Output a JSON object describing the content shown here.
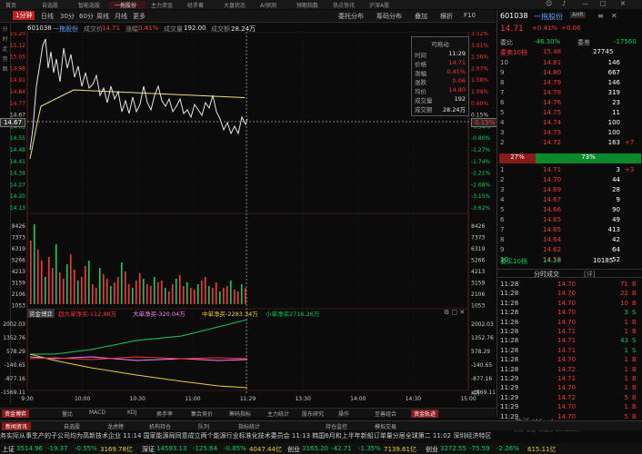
{
  "top_tabs": [
    "首页",
    "自选股",
    "智能选股",
    "一拖股份",
    "主力资金",
    "经手黄",
    "大盘状态",
    "AI预测",
    "预期指数",
    "热点快讯",
    "沪深A股"
  ],
  "active_top_tab_index": 3,
  "toolbar": {
    "period_label": "1分钟",
    "items": [
      "日线",
      "30分",
      "60分",
      "周线",
      "月线",
      "更多"
    ],
    "menus": [
      "委托分布",
      "筹码分布",
      "叠加",
      "横折"
    ],
    "f10": "F10"
  },
  "chart_info": {
    "code": "601038",
    "name": "一拖股份",
    "price_label": "成交价",
    "price": "14.71",
    "change_label": "涨幅",
    "change": "0.41%",
    "volume_label": "成交量",
    "volume": "192.00",
    "amount_label": "成交额",
    "amount": "28.24万"
  },
  "left_strip": [
    "分",
    "时",
    "走",
    "势",
    "图"
  ],
  "price_axis_left": [
    "15.20",
    "15.12",
    "15.05",
    "14.98",
    "14.91",
    "14.84",
    "14.77",
    "14.67",
    "14.61",
    "14.55",
    "14.48",
    "14.41",
    "14.34",
    "14.27",
    "14.20",
    "14.13"
  ],
  "price_axis_right": [
    "3.52%",
    "3.01%",
    "2.56%",
    "2.07%",
    "1.58%",
    "1.09%",
    "0.60%",
    "0.15%",
    "-0.34%",
    "-0.80%",
    "-1.27%",
    "-1.74%",
    "-2.21%",
    "-2.68%",
    "-3.15%",
    "-3.62%"
  ],
  "current_price_marker": "14.67",
  "current_pct_marker": "0.15%",
  "volume_axis": [
    "8426",
    "7373",
    "6319",
    "5266",
    "4213",
    "3159",
    "2106",
    "1053"
  ],
  "volume_axis_right": [
    "8426",
    "7373",
    "6319",
    "5266",
    "4213",
    "3159",
    "2106",
    "1053"
  ],
  "flow_legend": {
    "title": "资金博弈",
    "super": "超大单净买-112.88万",
    "big": "大单净买-320.04万",
    "mid": "中单净买-2283.34万",
    "small": "小单净买2716.26万"
  },
  "flow_axis": [
    "2002.03",
    "1352.76",
    "578.29",
    "-140.65",
    "-877.16",
    "-1569.11"
  ],
  "flow_axis_right": [
    "2002.03",
    "1352.76",
    "578.29",
    "-140.65",
    "-877.16",
    "-1569.11"
  ],
  "flow_unit": "X万",
  "time_axis": [
    "9:30",
    "10:00",
    "10:30",
    "11:00",
    "11:29",
    "13:30",
    "14:00",
    "14:30",
    "15:00"
  ],
  "cursor_time": "11:29",
  "tooltip": {
    "title": "可拖动",
    "rows": [
      {
        "k": "时间",
        "v": "11:29",
        "c": "white"
      },
      {
        "k": "价格",
        "v": "14.71",
        "c": "red"
      },
      {
        "k": "涨幅",
        "v": "0.41%",
        "c": "red"
      },
      {
        "k": "涨跌",
        "v": "0.06",
        "c": "red"
      },
      {
        "k": "均价",
        "v": "14.80",
        "c": "red"
      },
      {
        "k": "成交量",
        "v": "192",
        "c": "white"
      },
      {
        "k": "成交额",
        "v": "28.24万",
        "c": "white"
      }
    ]
  },
  "sidebar": {
    "code": "601038",
    "name": "一拖股份",
    "price": "14.71",
    "pct": "+0.41%",
    "chg": "+0.06",
    "wb_label": "委比",
    "wb": "-46.30%",
    "wc_label": "委差",
    "wc": "-17560",
    "sell_total_label": "委卖10档",
    "sell_total_price": "15.48",
    "sell_total_vol": "27745",
    "asks": [
      {
        "lvl": "10",
        "p": "14.81",
        "v": "146",
        "d": ""
      },
      {
        "lvl": "9",
        "p": "14.80",
        "v": "667",
        "d": ""
      },
      {
        "lvl": "8",
        "p": "14.79",
        "v": "146",
        "d": ""
      },
      {
        "lvl": "7",
        "p": "14.78",
        "v": "319",
        "d": ""
      },
      {
        "lvl": "6",
        "p": "14.76",
        "v": "23",
        "d": ""
      },
      {
        "lvl": "5",
        "p": "14.75",
        "v": "11",
        "d": ""
      },
      {
        "lvl": "4",
        "p": "14.74",
        "v": "100",
        "d": ""
      },
      {
        "lvl": "3",
        "p": "14.73",
        "v": "100",
        "d": ""
      },
      {
        "lvl": "2",
        "p": "14.72",
        "v": "163",
        "d": "+7"
      }
    ],
    "ratio_left": "27%",
    "ratio_right": "73%",
    "bids": [
      {
        "lvl": "1",
        "p": "14.71",
        "v": "3",
        "d": "+3"
      },
      {
        "lvl": "2",
        "p": "14.70",
        "v": "44",
        "d": ""
      },
      {
        "lvl": "3",
        "p": "14.69",
        "v": "28",
        "d": ""
      },
      {
        "lvl": "4",
        "p": "14.67",
        "v": "9",
        "d": ""
      },
      {
        "lvl": "5",
        "p": "14.66",
        "v": "90",
        "d": ""
      },
      {
        "lvl": "6",
        "p": "14.65",
        "v": "49",
        "d": ""
      },
      {
        "lvl": "7",
        "p": "14.65",
        "v": "413",
        "d": ""
      },
      {
        "lvl": "8",
        "p": "14.64",
        "v": "42",
        "d": ""
      },
      {
        "lvl": "9",
        "p": "14.62",
        "v": "64",
        "d": ""
      },
      {
        "lvl": "10",
        "p": "14.58",
        "v": "52",
        "d": ""
      }
    ],
    "buy_total_label": "委买10档",
    "buy_total_price": "14.18",
    "buy_total_vol": "10185",
    "trades_title": "分时成交",
    "trades_btn": "[详]",
    "trades": [
      {
        "t": "11:28",
        "p": "14.70",
        "v": "71",
        "s": "B",
        "c": "red"
      },
      {
        "t": "11:28",
        "p": "14.70",
        "v": "22",
        "s": "B",
        "c": "red"
      },
      {
        "t": "11:28",
        "p": "14.70",
        "v": "10",
        "s": "B",
        "c": "red"
      },
      {
        "t": "11:28",
        "p": "14.70",
        "v": "3",
        "s": "S",
        "c": "green"
      },
      {
        "t": "11:28",
        "p": "14.70",
        "v": "1",
        "s": "B",
        "c": "red"
      },
      {
        "t": "11:28",
        "p": "14.71",
        "v": "1",
        "s": "B",
        "c": "red"
      },
      {
        "t": "11:28",
        "p": "14.71",
        "v": "43",
        "s": "S",
        "c": "green"
      },
      {
        "t": "11:28",
        "p": "14.71",
        "v": "1",
        "s": "S",
        "c": "green"
      },
      {
        "t": "11:28",
        "p": "14.70",
        "v": "1",
        "s": "B",
        "c": "red"
      },
      {
        "t": "11:28",
        "p": "14.72",
        "v": "1",
        "s": "B",
        "c": "red"
      },
      {
        "t": "11:29",
        "p": "14.71",
        "v": "1",
        "s": "B",
        "c": "red"
      },
      {
        "t": "11:29",
        "p": "14.70",
        "v": "1",
        "s": "B",
        "c": "red"
      },
      {
        "t": "11:29",
        "p": "14.72",
        "v": "5",
        "s": "B",
        "c": "red"
      },
      {
        "t": "11:29",
        "p": "14.70",
        "v": "1",
        "s": "B",
        "c": "red"
      },
      {
        "t": "11:29",
        "p": "14.70",
        "v": "5",
        "s": "B",
        "c": "red"
      }
    ],
    "watermark": "激活 Windows",
    "watermark_sub": "转到\"设置\"以激活 Windows。"
  },
  "bottom_tabs": [
    "资金博弈",
    "量比",
    "MACD",
    "KDJ",
    "换手率",
    "集合竞价",
    "筹码指标",
    "主力统计",
    "股东研究",
    "操作",
    "至善组合",
    "资金轨迹"
  ],
  "bottom_tabs2": [
    "新闻资讯",
    "自选股",
    "龙虎榜",
    "机构持仓",
    "队列",
    "指标统计",
    "持仓监控",
    "模拟交易"
  ],
  "news": "务实际从事生产的子公司均为高新技术企业   11:14 国家能源局同意成立两个能源行业标准化技术委员会   11:13 韩国6月和上半年新船订单量分居全球第二   11:02 深圳经济特区",
  "indices": [
    {
      "n": "上证",
      "v": "3514.96",
      "c": "-19.37",
      "p": "-0.55%",
      "a": "3169.78亿"
    },
    {
      "n": "深证",
      "v": "14593.13",
      "c": "-125.64",
      "p": "-0.85%",
      "a": "4047.44亿"
    },
    {
      "n": "创业",
      "v": "3165.20",
      "c": "-42.71",
      "p": "-1.35%",
      "a": "7139.61亿"
    },
    {
      "n": "创业",
      "v": "3272.55",
      "c": "-75.59",
      "p": "-2.26%",
      "a": "615.11亿"
    }
  ],
  "colors": {
    "up": "#ff3232",
    "down": "#00d35a",
    "avg": "#f0e080",
    "price_line": "#e6e6e6"
  }
}
